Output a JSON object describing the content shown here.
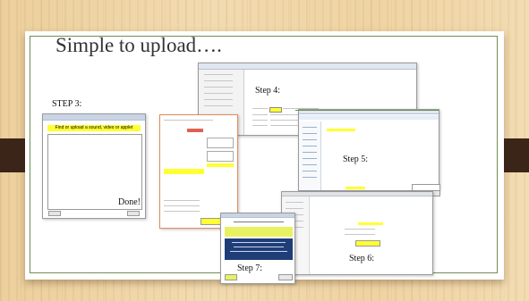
{
  "slide": {
    "title": "Simple to upload….",
    "labels": {
      "step3": "STEP 3:",
      "step4": "Step 4:",
      "step5": "Step 5:",
      "step6": "Step 6:",
      "step7": "Step 7:",
      "done": "Done!"
    }
  },
  "shots": {
    "step3_prompt": "Find or upload a sound, video or applet"
  },
  "colors": {
    "frame": "#6f8f52",
    "side_block": "#3b2418",
    "highlight": "#ffff33",
    "dark_titlebar": "#1f3e78",
    "yellow_button": "#e8f260"
  }
}
